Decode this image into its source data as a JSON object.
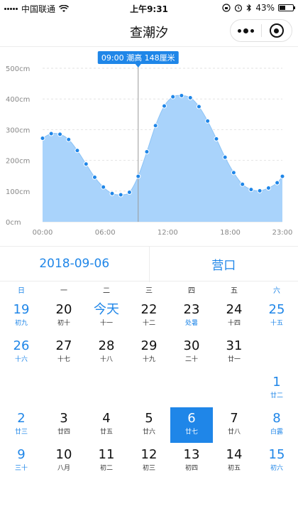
{
  "status_bar": {
    "carrier": "中国联通",
    "time": "上午9:31",
    "battery": "43%",
    "battery_level": 0.43
  },
  "nav": {
    "title": "查潮汐"
  },
  "chart_data": {
    "type": "area",
    "x_start": "00:00",
    "x_end": "23:00",
    "x_ticks": [
      "00:00",
      "06:00",
      "12:00",
      "18:00",
      "23:00"
    ],
    "x_tick_hours": [
      0,
      6,
      12,
      18,
      23
    ],
    "y_ticks": [
      "0cm",
      "100cm",
      "200cm",
      "300cm",
      "400cm",
      "500cm"
    ],
    "y_tick_values": [
      0,
      100,
      200,
      300,
      400,
      500
    ],
    "ylim": [
      0,
      500
    ],
    "xlim_hours": [
      0,
      23
    ],
    "grid": true,
    "fill_color": "#a9d3fb",
    "point_color": "#1f86e8",
    "series": [
      {
        "x_hours": [
          0,
          0.83,
          1.67,
          2.5,
          3.33,
          4.17,
          5,
          5.83,
          6.67,
          7.5,
          8.33,
          9.17,
          10,
          10.83,
          11.67,
          12.5,
          13.33,
          14.17,
          15,
          15.83,
          16.67,
          17.5,
          18.33,
          19.17,
          20,
          20.83,
          21.67,
          22.5,
          23
        ],
        "values": [
          272,
          287,
          285,
          268,
          232,
          188,
          145,
          113,
          92,
          88,
          96,
          148,
          228,
          313,
          377,
          407,
          411,
          404,
          375,
          328,
          270,
          210,
          160,
          122,
          105,
          101,
          110,
          127,
          148
        ]
      }
    ],
    "annotation": {
      "label": "09:00 潮高 148厘米",
      "x_hour": 9.17,
      "value": 148,
      "color": "#1f86e8"
    }
  },
  "info": {
    "date": "2018-09-06",
    "location": "营口"
  },
  "calendar": {
    "week_headers": [
      "日",
      "一",
      "二",
      "三",
      "四",
      "五",
      "六"
    ],
    "cells": [
      {
        "num": "19",
        "sub": "初九"
      },
      {
        "num": "20",
        "sub": "初十"
      },
      {
        "num": "今天",
        "sub": "十一",
        "today": true
      },
      {
        "num": "22",
        "sub": "十二"
      },
      {
        "num": "23",
        "sub": "处暑",
        "term": true
      },
      {
        "num": "24",
        "sub": "十四"
      },
      {
        "num": "25",
        "sub": "十五"
      },
      {
        "num": "26",
        "sub": "十六"
      },
      {
        "num": "27",
        "sub": "十七"
      },
      {
        "num": "28",
        "sub": "十八"
      },
      {
        "num": "29",
        "sub": "十九"
      },
      {
        "num": "30",
        "sub": "二十"
      },
      {
        "num": "31",
        "sub": "廿一"
      },
      {
        "num": "",
        "sub": "",
        "empty": true
      },
      {
        "num": "",
        "sub": "",
        "empty": true
      },
      {
        "num": "",
        "sub": "",
        "empty": true
      },
      {
        "num": "",
        "sub": "",
        "empty": true
      },
      {
        "num": "",
        "sub": "",
        "empty": true
      },
      {
        "num": "",
        "sub": "",
        "empty": true
      },
      {
        "num": "",
        "sub": "",
        "empty": true
      },
      {
        "num": "1",
        "sub": "廿二"
      },
      {
        "num": "2",
        "sub": "廿三"
      },
      {
        "num": "3",
        "sub": "廿四"
      },
      {
        "num": "4",
        "sub": "廿五"
      },
      {
        "num": "5",
        "sub": "廿六"
      },
      {
        "num": "6",
        "sub": "廿七",
        "selected": true
      },
      {
        "num": "7",
        "sub": "廿八"
      },
      {
        "num": "8",
        "sub": "白露",
        "term": true
      },
      {
        "num": "9",
        "sub": "三十"
      },
      {
        "num": "10",
        "sub": "八月"
      },
      {
        "num": "11",
        "sub": "初二"
      },
      {
        "num": "12",
        "sub": "初三"
      },
      {
        "num": "13",
        "sub": "初四"
      },
      {
        "num": "14",
        "sub": "初五"
      },
      {
        "num": "15",
        "sub": "初六"
      }
    ]
  }
}
